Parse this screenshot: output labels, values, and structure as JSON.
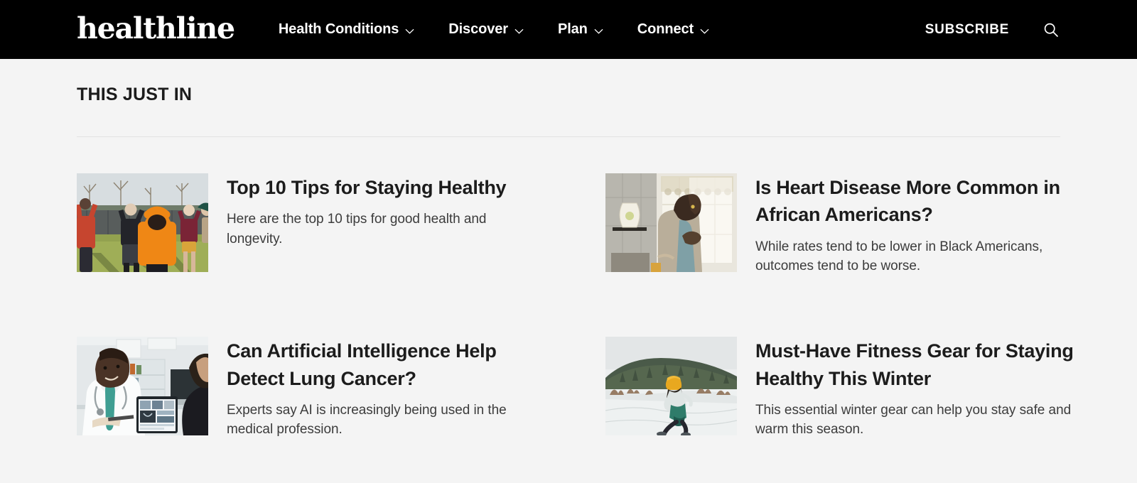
{
  "header": {
    "logo": "healthline",
    "nav": [
      {
        "label": "Health Conditions",
        "icon": "chevron-down-icon"
      },
      {
        "label": "Discover",
        "icon": "chevron-down-icon"
      },
      {
        "label": "Plan",
        "icon": "chevron-down-icon"
      },
      {
        "label": "Connect",
        "icon": "chevron-down-icon"
      }
    ],
    "subscribe_label": "SUBSCRIBE",
    "search_icon": "search-icon",
    "background_color": "#000000",
    "text_color": "#ffffff"
  },
  "section": {
    "title": "THIS JUST IN",
    "divider_color": "#e2e2e2",
    "background_color": "#f4f4f4"
  },
  "articles": [
    {
      "title": "Top 10 Tips for Staying Healthy",
      "description": "Here are the top 10 tips for good health and longevity.",
      "thumbnail": "outdoor-group-exercise-photo"
    },
    {
      "title": "Is Heart Disease More Common in African Americans?",
      "description": "While rates tend to be lower in Black Americans, outcomes tend to be worse.",
      "thumbnail": "person-by-window-hand-on-chest-photo"
    },
    {
      "title": "Can Artificial Intelligence Help Detect Lung Cancer?",
      "description": "Experts say AI is increasingly being used in the medical profession.",
      "thumbnail": "doctor-with-tablet-photo"
    },
    {
      "title": "Must-Have Fitness Gear for Staying Healthy This Winter",
      "description": "This essential winter gear can help you stay safe and warm this season.",
      "thumbnail": "winter-runner-snow-photo"
    }
  ]
}
